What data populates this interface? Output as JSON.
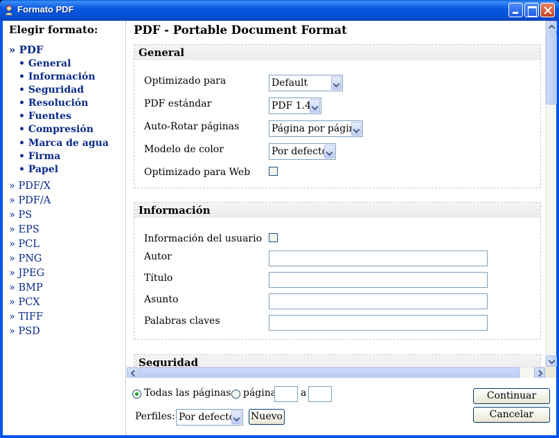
{
  "window": {
    "title": "Formato PDF"
  },
  "nav": {
    "heading": "Elegir formato:",
    "items": [
      {
        "label": "» PDF",
        "kind": "active"
      },
      {
        "label": "• General",
        "kind": "sub"
      },
      {
        "label": "• Información",
        "kind": "sub"
      },
      {
        "label": "• Seguridad",
        "kind": "sub"
      },
      {
        "label": "• Resolución",
        "kind": "sub"
      },
      {
        "label": "• Fuentes",
        "kind": "sub"
      },
      {
        "label": "• Compresión",
        "kind": "sub"
      },
      {
        "label": "• Marca de agua",
        "kind": "sub"
      },
      {
        "label": "• Firma",
        "kind": "sub"
      },
      {
        "label": "• Papel",
        "kind": "sub"
      },
      {
        "label": "» PDF/X",
        "kind": "format"
      },
      {
        "label": "» PDF/A",
        "kind": "format"
      },
      {
        "label": "» PS",
        "kind": "format"
      },
      {
        "label": "» EPS",
        "kind": "format"
      },
      {
        "label": "» PCL",
        "kind": "format"
      },
      {
        "label": "» PNG",
        "kind": "format"
      },
      {
        "label": "» JPEG",
        "kind": "format"
      },
      {
        "label": "» BMP",
        "kind": "format"
      },
      {
        "label": "» PCX",
        "kind": "format"
      },
      {
        "label": "» TIFF",
        "kind": "format"
      },
      {
        "label": "» PSD",
        "kind": "format"
      }
    ]
  },
  "main": {
    "title": "PDF - Portable Document Format",
    "general": {
      "heading": "General",
      "optimized_label": "Optimizado para",
      "optimized_value": "Default",
      "standard_label": "PDF estándar",
      "standard_value": "PDF 1.4",
      "autorotate_label": "Auto-Rotar páginas",
      "autorotate_value": "Página por página",
      "color_label": "Modelo de color",
      "color_value": "Por defecto",
      "web_label": "Optimizado para Web",
      "web_checked": false
    },
    "info": {
      "heading": "Información",
      "user_info_label": "Información del usuario",
      "user_info_checked": false,
      "author_label": "Autor",
      "author_value": "",
      "title_label": "Título",
      "title_value": "",
      "subject_label": "Asunto",
      "subject_value": "",
      "keywords_label": "Palabras claves",
      "keywords_value": ""
    },
    "security": {
      "heading": "Seguridad"
    }
  },
  "footer": {
    "all_pages_label": "Todas las páginas",
    "page_label": "página",
    "to_label": "a",
    "from_value": "",
    "to_value": "",
    "profiles_label": "Perfiles:",
    "profile_value": "Por defecto",
    "new_label": "Nuevo",
    "continue_label": "Continuar",
    "cancel_label": "Cancelar"
  },
  "colors": {
    "titlebar": "#0054e3",
    "nav_text": "#0a2a8a",
    "radio_on": "#21a121"
  }
}
